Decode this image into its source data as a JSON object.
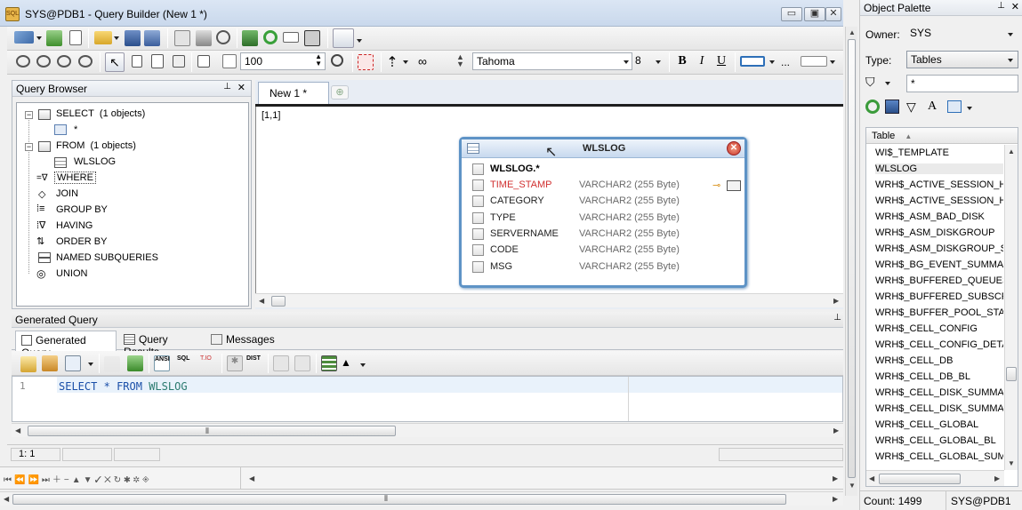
{
  "window": {
    "title": "SYS@PDB1 - Query Builder (New 1 *)",
    "app_icon_text": "SQL"
  },
  "toolbar2": {
    "zoom_value": "100",
    "font_name": "Tahoma",
    "font_size": "8",
    "bold": "B",
    "italic": "I",
    "underline": "U",
    "more": "..."
  },
  "query_browser": {
    "title": "Query Browser",
    "items": [
      {
        "label": "SELECT",
        "suffix": "(1 objects)"
      },
      {
        "label": "*"
      },
      {
        "label": "FROM",
        "suffix": "(1 objects)"
      },
      {
        "label": "WLSLOG"
      },
      {
        "label": "WHERE"
      },
      {
        "label": "JOIN"
      },
      {
        "label": "GROUP BY"
      },
      {
        "label": "HAVING"
      },
      {
        "label": "ORDER BY"
      },
      {
        "label": "NAMED SUBQUERIES"
      },
      {
        "label": "UNION"
      }
    ]
  },
  "editor": {
    "tab_label": "New 1 *",
    "position": "[1,1]",
    "table_box": {
      "title": "WLSLOG",
      "all_columns": "WLSLOG.*",
      "columns": [
        {
          "name": "TIME_STAMP",
          "type": "VARCHAR2 (255 Byte)",
          "key": true
        },
        {
          "name": "CATEGORY",
          "type": "VARCHAR2 (255 Byte)"
        },
        {
          "name": "TYPE",
          "type": "VARCHAR2 (255 Byte)"
        },
        {
          "name": "SERVERNAME",
          "type": "VARCHAR2 (255 Byte)"
        },
        {
          "name": "CODE",
          "type": "VARCHAR2 (255 Byte)"
        },
        {
          "name": "MSG",
          "type": "VARCHAR2 (255 Byte)"
        }
      ]
    }
  },
  "generated_query": {
    "title": "Generated Query",
    "tabs": [
      "Generated Query",
      "Query Results",
      "Messages"
    ],
    "line_number": "1",
    "sql": {
      "kw1": "SELECT",
      "star": "*",
      "kw2": "FROM",
      "table": "WLSLOG"
    },
    "tool_text": {
      "ansi": "ANSI",
      "dist": "DIST"
    }
  },
  "status": {
    "cursor": "1:  1"
  },
  "object_palette": {
    "title": "Object Palette",
    "owner_label": "Owner:",
    "owner_value": "SYS",
    "type_label": "Type:",
    "type_value": "Tables",
    "filter_value": "*",
    "column_header": "Table",
    "tables": [
      "WI$_TEMPLATE",
      "WLSLOG",
      "WRH$_ACTIVE_SESSION_HIS",
      "WRH$_ACTIVE_SESSION_HIS",
      "WRH$_ASM_BAD_DISK",
      "WRH$_ASM_DISKGROUP",
      "WRH$_ASM_DISKGROUP_STA",
      "WRH$_BG_EVENT_SUMMARY",
      "WRH$_BUFFERED_QUEUES",
      "WRH$_BUFFERED_SUBSCRIBE",
      "WRH$_BUFFER_POOL_STATIS",
      "WRH$_CELL_CONFIG",
      "WRH$_CELL_CONFIG_DETAIL",
      "WRH$_CELL_DB",
      "WRH$_CELL_DB_BL",
      "WRH$_CELL_DISK_SUMMARY",
      "WRH$_CELL_DISK_SUMMARY_",
      "WRH$_CELL_GLOBAL",
      "WRH$_CELL_GLOBAL_BL",
      "WRH$_CELL_GLOBAL_SUMMA"
    ],
    "count": "Count: 1499",
    "connection": "SYS@PDB1"
  }
}
